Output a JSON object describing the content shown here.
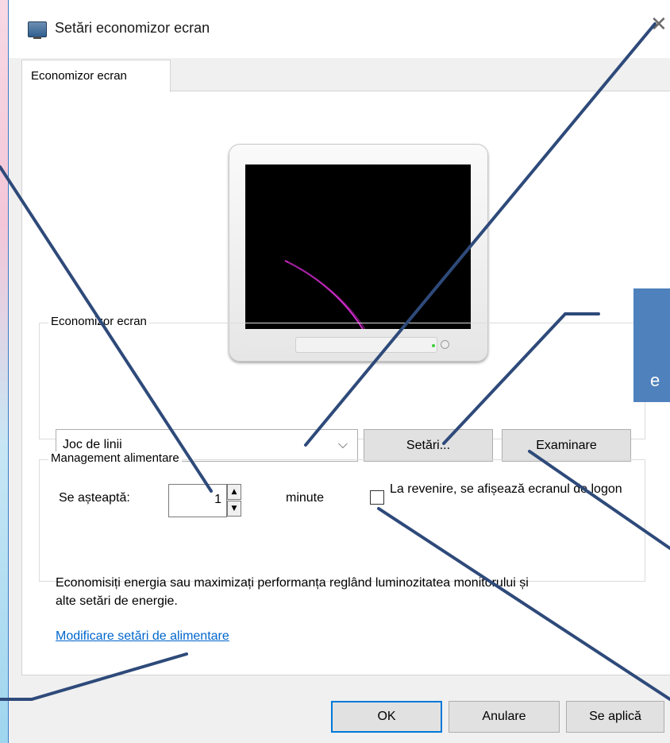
{
  "window": {
    "title": "Setări economizor ecran",
    "close_glyph": "✕",
    "icon": "display-properties-icon"
  },
  "tabs": [
    {
      "label": "Economizor ecran",
      "selected": true
    }
  ],
  "screensaver_group": {
    "legend": "Economizor ecran",
    "selected_screensaver": "Joc de linii",
    "chevron": "⌵",
    "settings_button": "Setări...",
    "preview_button": "Examinare",
    "wait_label": "Se așteaptă:",
    "wait_value": "1",
    "spin_up": "▲",
    "spin_down": "▼",
    "minutes_label": "minute",
    "logon_checkbox_label": "La revenire, se afișează ecranul de logon",
    "logon_checkbox_checked": false
  },
  "power_group": {
    "legend": "Management alimentare",
    "description": "Economisiți energia sau maximizați performanța reglând luminozitatea monitorului și alte setări de energie.",
    "link": "Modificare setări de alimentare"
  },
  "footer_buttons": {
    "ok": "OK",
    "cancel": "Anulare",
    "apply": "Se aplică"
  },
  "callout": {
    "text": "e"
  },
  "colors": {
    "accent": "#0078d7",
    "link": "#0066cc",
    "callout_fill": "#4f81bd",
    "annotation_line": "#2e4a7a",
    "preview_line": "#d62ad0"
  }
}
